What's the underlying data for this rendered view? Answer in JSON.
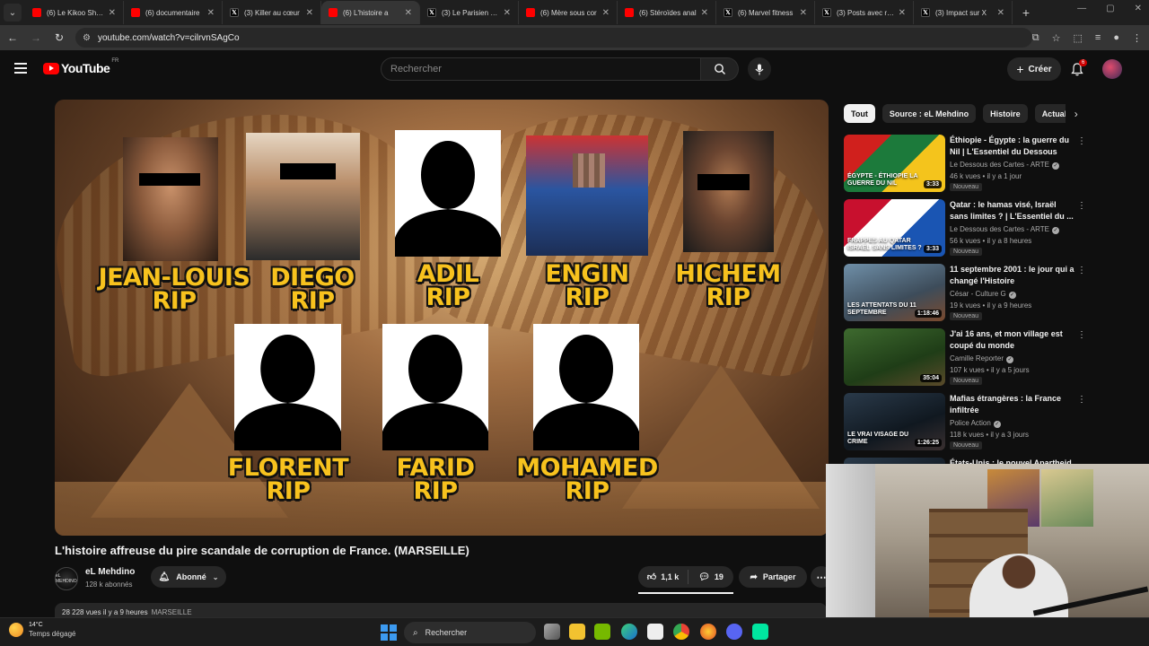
{
  "browser": {
    "tabs": [
      {
        "label": "(6) Le Kikoo Show",
        "icon": "youtube-favicon"
      },
      {
        "label": "(6) documentaire",
        "icon": "youtube-favicon"
      },
      {
        "label": "(3) Killer au cœur",
        "icon": "x-favicon"
      },
      {
        "label": "(6) L'histoire a",
        "icon": "youtube-favicon",
        "active": true
      },
      {
        "label": "(3) Le Parisien sur",
        "icon": "x-favicon"
      },
      {
        "label": "(6) Mère sous cor",
        "icon": "youtube-favicon"
      },
      {
        "label": "(6) Stéroïdes anal",
        "icon": "youtube-favicon"
      },
      {
        "label": "(6) Marvel fitness",
        "icon": "x-favicon"
      },
      {
        "label": "(3) Posts avec rép",
        "icon": "x-favicon"
      },
      {
        "label": "(3) Impact sur X",
        "icon": "x-favicon"
      }
    ],
    "url": "youtube.com/watch?v=cilrvnSAgCo"
  },
  "youtube": {
    "logo_word": "YouTube",
    "country": "FR",
    "search_placeholder": "Rechercher",
    "create_label": "Créer",
    "notif_count": "6"
  },
  "video": {
    "title": "L'histoire affreuse du pire scandale de corruption de France. (MARSEILLE)",
    "channel": "eL Mehdino",
    "channel_avatar_text": "eL MEHDINO",
    "subscribers": "128 k abonnés",
    "subscribed_label": "Abonné",
    "likes": "1,1 k",
    "comments": "19",
    "share_label": "Partager",
    "views_line": "28 228 vues  il y a 9 heures",
    "tag": "MARSEILLE",
    "thumbnail_people": [
      {
        "name": "JEAN-LOUIS",
        "rip": "RIP"
      },
      {
        "name": "DIEGO",
        "rip": "RIP"
      },
      {
        "name": "ADIL",
        "rip": "RIP"
      },
      {
        "name": "ENGIN",
        "rip": "RIP"
      },
      {
        "name": "HICHEM",
        "rip": "RIP"
      },
      {
        "name": "FLORENT",
        "rip": "RIP"
      },
      {
        "name": "FARID",
        "rip": "RIP"
      },
      {
        "name": "MOHAMED",
        "rip": "RIP"
      }
    ]
  },
  "chips": [
    "Tout",
    "Source : eL Mehdino",
    "Histoire",
    "Actualités"
  ],
  "recommendations": [
    {
      "title": "Éthiopie - Égypte : la guerre du Nil | L'Essentiel du Dessous de...",
      "channel": "Le Dessous des Cartes - ARTE",
      "meta": "46 k vues • il y a 1 jour",
      "badge": "Nouveau",
      "duration": "3:33",
      "overlay": "ÉGYPTE - ÉTHIOPIE LA GUERRE DU NIL"
    },
    {
      "title": "Qatar : le hamas visé, Israël sans limites ? | L'Essentiel du ...",
      "channel": "Le Dessous des Cartes - ARTE",
      "meta": "56 k vues • il y a 8 heures",
      "badge": "Nouveau",
      "duration": "3:33",
      "overlay": "FRAPPES AU QATAR ISRAËL SANS LIMITES ?"
    },
    {
      "title": "11 septembre 2001 : le jour qui a changé l'Histoire",
      "channel": "César - Culture G",
      "meta": "19 k vues • il y a 9 heures",
      "badge": "Nouveau",
      "duration": "1:18:46",
      "overlay": "LES ATTENTATS DU 11 SEPTEMBRE"
    },
    {
      "title": "J'ai 16 ans, et mon village est coupé du monde",
      "channel": "Camille Reporter",
      "meta": "107 k vues • il y a 5 jours",
      "badge": "Nouveau",
      "duration": "35:04",
      "overlay": ""
    },
    {
      "title": "Mafias étrangères : la France infiltrée",
      "channel": "Police Action",
      "meta": "118 k vues • il y a 3 jours",
      "badge": "Nouveau",
      "duration": "1:26:25",
      "overlay": "LE VRAI VISAGE DU CRIME"
    },
    {
      "title": "États-Unis : le nouvel Apartheid",
      "channel": "",
      "meta": "",
      "badge": "",
      "duration": "",
      "overlay": ""
    }
  ],
  "taskbar": {
    "temp": "14°C",
    "condition": "Temps dégagé",
    "search_label": "Rechercher"
  }
}
